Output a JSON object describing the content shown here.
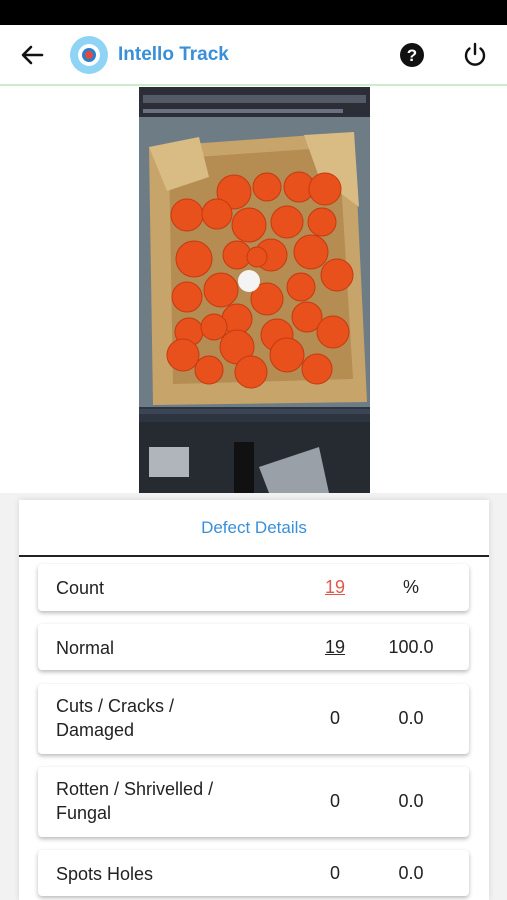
{
  "header": {
    "title": "Intello Track",
    "icons": [
      "back-arrow-icon",
      "app-logo-icon",
      "help-icon",
      "power-icon"
    ]
  },
  "defect_details": {
    "title": "Defect Details",
    "rows": [
      {
        "label": "Count",
        "count": "19",
        "percent": "%"
      },
      {
        "label": "Normal",
        "count": "19",
        "percent": "100.0"
      },
      {
        "label": "Cuts / Cracks / Damaged",
        "line1": "Cuts / Cracks /",
        "line2": "Damaged",
        "count": "0",
        "percent": "0.0"
      },
      {
        "label": "Rotten / Shrivelled / Fungal",
        "line1": "Rotten / Shrivelled /",
        "line2": "Fungal",
        "count": "0",
        "percent": "0.0"
      },
      {
        "label": "Spots Holes",
        "count": "0",
        "percent": "0.0"
      }
    ]
  },
  "colors": {
    "accent": "#3a8fd9",
    "count_highlight": "#e0584e",
    "tomato": "#e8511c"
  }
}
